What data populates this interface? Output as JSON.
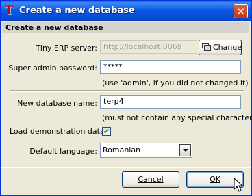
{
  "window": {
    "title": "Create a new database",
    "app_icon_glyph": "T",
    "close_glyph": "✕"
  },
  "panel": {
    "title": "Create a new database"
  },
  "server": {
    "label": "Tiny ERP server:",
    "value": "http://localhost:8069",
    "change_label": "Change"
  },
  "admin_password": {
    "label": "Super admin password:",
    "value": "*****",
    "hint": "(use 'admin', if you did not changed it)"
  },
  "db_name": {
    "label": "New database name:",
    "value": "terp4",
    "hint": "(must not contain any special character)"
  },
  "demo_data": {
    "label": "Load demonstration data:",
    "checked": true
  },
  "language": {
    "label": "Default language:",
    "selected": "Romanian"
  },
  "buttons": {
    "cancel": "Cancel",
    "ok": "OK"
  },
  "colors": {
    "titlebar": "#0b5ae3",
    "window_bg": "#ece9d8",
    "field_border": "#7f9db9",
    "close_button": "#c13a15"
  }
}
